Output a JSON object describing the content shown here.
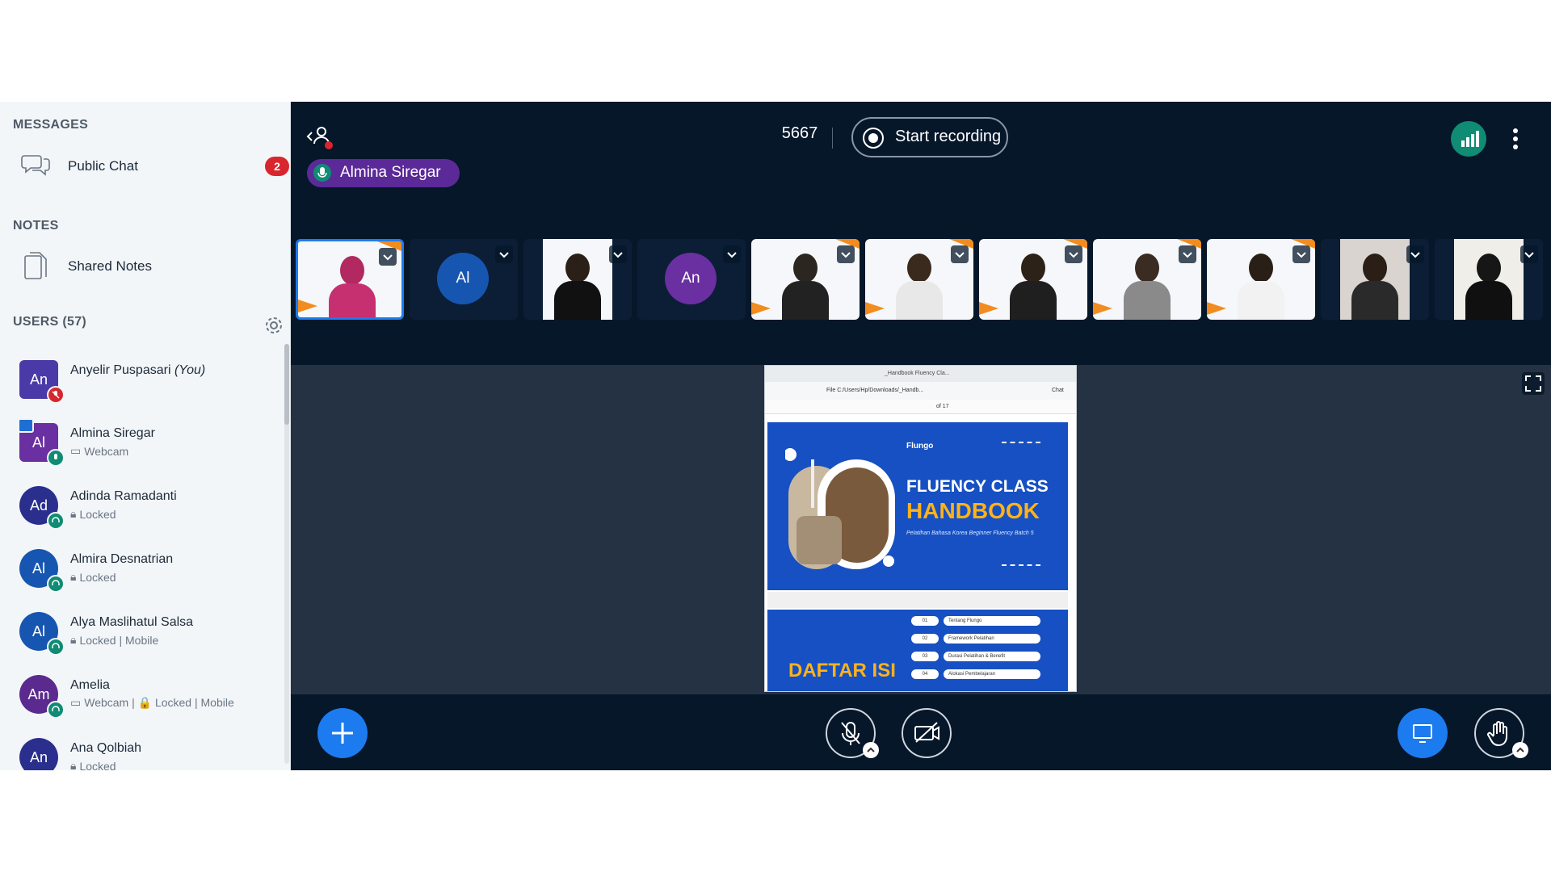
{
  "sidebar": {
    "messages_title": "MESSAGES",
    "public_chat_label": "Public Chat",
    "public_chat_unread": "2",
    "notes_title": "NOTES",
    "shared_notes_label": "Shared Notes",
    "users_title": "USERS (57)",
    "users": [
      {
        "initials": "An",
        "name": "Anyelir Puspasari",
        "you_label": "(You)",
        "status": "",
        "color": "#4a3aa8"
      },
      {
        "initials": "Al",
        "name": "Almina Siregar",
        "you_label": "",
        "status": "Webcam",
        "color": "#6a2fa0"
      },
      {
        "initials": "Ad",
        "name": "Adinda Ramadanti",
        "you_label": "",
        "status": "Locked",
        "color": "#2a2f8e"
      },
      {
        "initials": "Al",
        "name": "Almira Desnatrian",
        "you_label": "",
        "status": "Locked",
        "color": "#1656b0"
      },
      {
        "initials": "Al",
        "name": "Alya Maslihatul Salsa",
        "you_label": "",
        "status": "Locked | Mobile",
        "color": "#1656b0"
      },
      {
        "initials": "Am",
        "name": "Amelia",
        "you_label": "",
        "status": "Webcam | 🔒 Locked | Mobile",
        "color": "#5a2a8e"
      },
      {
        "initials": "An",
        "name": "Ana Qolbiah",
        "you_label": "",
        "status": "Locked",
        "color": "#2a2f8e"
      }
    ]
  },
  "topbar": {
    "meeting_id": "5667",
    "record_label": "Start recording",
    "talker_name": "Almina Siregar"
  },
  "video_strip": {
    "avatar_tiles": [
      "Al",
      "An"
    ]
  },
  "slide": {
    "tab_text": "_Handbook Fluency Cla...",
    "address": "File   C:/Users/Hp/Downloads/_Handb...",
    "page_info": "of 17",
    "chat_label": "Chat",
    "brand": "Flungo",
    "title_line1": "FLUENCY CLASS",
    "title_line2": "HANDBOOK",
    "subtitle": "Pelatihan Bahasa Korea Beginner Fluency Batch 5",
    "daftar_title": "DAFTAR ISI",
    "toc": [
      {
        "num": "01",
        "label": "Tentang Flungo"
      },
      {
        "num": "02",
        "label": "Framework Pelatihan"
      },
      {
        "num": "03",
        "label": "Durasi Pelatihan & Benefit"
      },
      {
        "num": "04",
        "label": "Alokasi Pembelajaran"
      }
    ]
  },
  "colors": {
    "app_bg": "#06172a",
    "accent_blue": "#1d7bf0",
    "talker_purple": "#5b2a98",
    "connection_green": "#0f8c73",
    "badge_red": "#d8262e",
    "slide_blue": "#1650c2",
    "slide_orange": "#ffb21a"
  },
  "icons": [
    "chat-icon",
    "notes-icon",
    "gear-icon",
    "user-list-toggle-icon",
    "record-icon",
    "connection-bars-icon",
    "kebab-menu-icon",
    "microphone-icon",
    "fullscreen-icon",
    "plus-icon",
    "mic-muted-icon",
    "camera-off-icon",
    "presentation-icon",
    "raise-hand-icon",
    "chevron-down-icon",
    "headset-icon",
    "lock-icon",
    "webcam-icon"
  ]
}
